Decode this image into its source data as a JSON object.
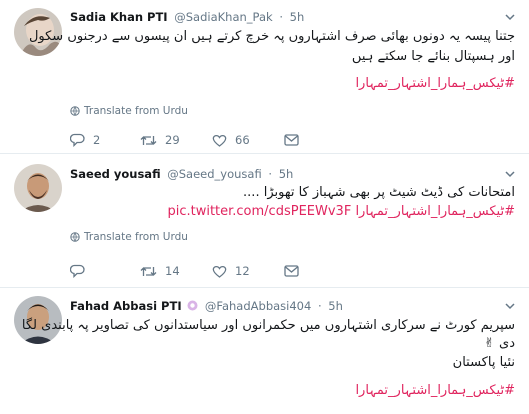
{
  "tweets": [
    {
      "name": "Sadia Khan PTI",
      "handle": "@SadiaKhan_Pak",
      "separator": "·",
      "time": "5h",
      "line1": "جتنا پیسہ یہ دونوں بھائی صرف اشتہاروں پہ خرچ کرتے ہیں ان پیسوں سے درجنوں سکول",
      "line2": "اور ہسپتال بنائے جا سکتے ہیں",
      "hashtag": "#ٹیکس_ہمارا_اشتہار_تمہارا",
      "translate": "Translate from Urdu",
      "replies": "2",
      "retweets": "29",
      "likes": "66"
    },
    {
      "name": "Saeed yousafi",
      "handle": "@Saeed_yousafi",
      "separator": "·",
      "time": "5h",
      "line1": "امتحانات کی ڈیٹ شیٹ پر بھی شہباز کا تھوبڑا ....",
      "hashtag": "#ٹیکس_ہمارا_اشتہار_تمہارا",
      "link": "pic.twitter.com/cdsPEEWv3F",
      "translate": "Translate from Urdu",
      "replies": "",
      "retweets": "14",
      "likes": "12"
    },
    {
      "name": "Fahad Abbasi PTI",
      "handle": "@FahadAbbasi404",
      "separator": "·",
      "time": "5h",
      "line1": "سپریم کورٹ نے سرکاری اشتہاروں میں حکمرانوں اور سیاستدانوں کی تصاویر پہ پابندی لگا",
      "line2": "دی ✌",
      "line3": "نئیا پاکستان",
      "hashtag": "#ٹیکس_ہمارا_اشتہار_تمہارا"
    }
  ],
  "colors": {
    "accent": "#e0245e",
    "meta": "#657786",
    "border": "#e6ecf0"
  },
  "icons": [
    "reply-icon",
    "retweet-icon",
    "like-icon",
    "message-icon",
    "globe-icon",
    "chevron-down-icon",
    "badge-icon"
  ]
}
